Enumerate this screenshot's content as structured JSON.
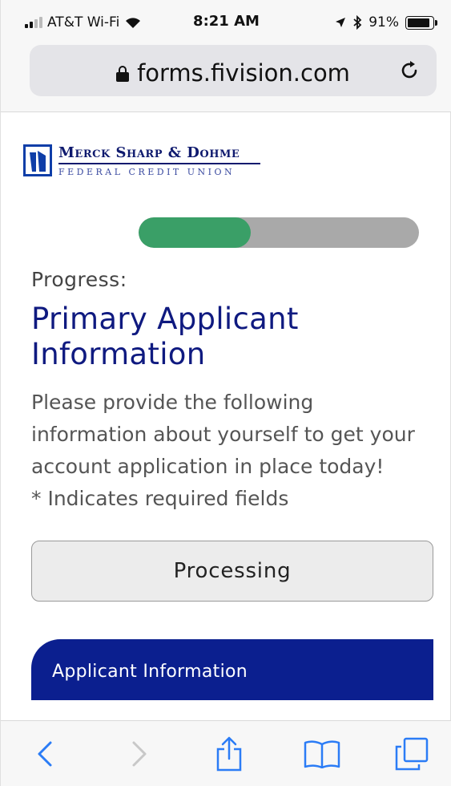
{
  "status_bar": {
    "carrier": "AT&T Wi-Fi",
    "time": "8:21 AM",
    "battery": "91%",
    "battery_level": 0.91
  },
  "browser": {
    "url": "forms.fivision.com"
  },
  "logo": {
    "line1": "Merck Sharp & Dohme",
    "line2": "FEDERAL CREDIT UNION"
  },
  "progress": {
    "fraction": 0.4,
    "label": "Progress:"
  },
  "page": {
    "title": "Primary Applicant Information",
    "intro": "Please provide the following information about yourself to get your account application in place today!",
    "required_note": "* Indicates required fields"
  },
  "processing_button": {
    "label": "Processing"
  },
  "applicant_panel": {
    "title": "Applicant Information"
  },
  "colors": {
    "brand_blue": "#0b1f8f",
    "progress_green": "#3a9f67",
    "toolbar_blue": "#2b7cf6"
  }
}
